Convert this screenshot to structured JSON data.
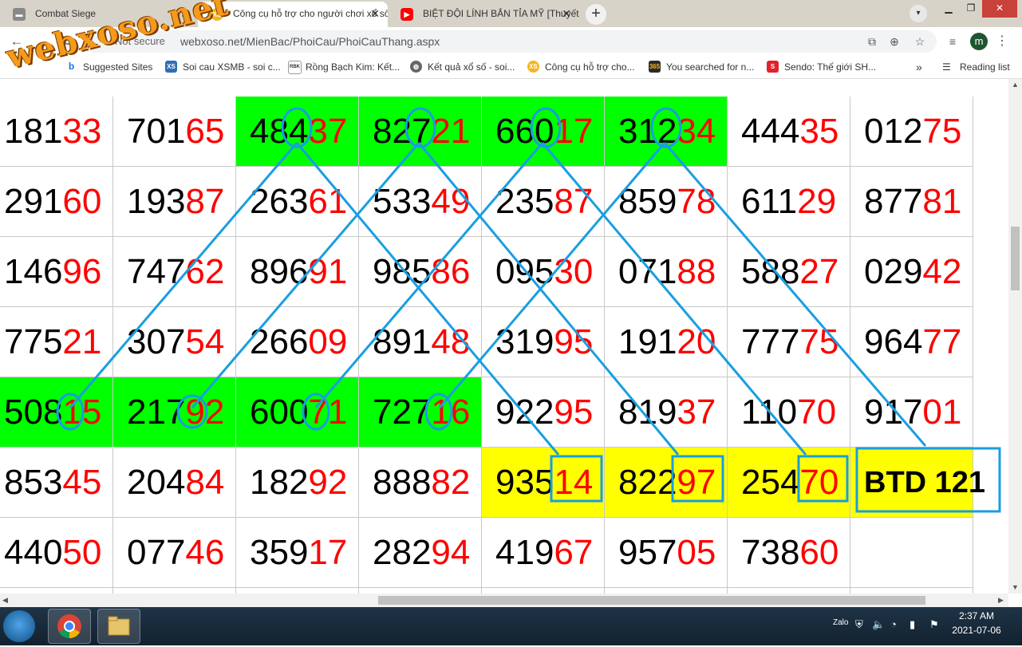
{
  "browser": {
    "tabs": [
      {
        "title": "Combat Siege",
        "icon": "game-icon"
      },
      {
        "title": "Công cụ hỗ trợ cho người chơi xổ số",
        "icon": "xs-icon"
      },
      {
        "title": "BIỆT ĐỘI LÍNH BẮN TỈA MỸ [Thuyết minh]",
        "icon": "youtube-icon"
      }
    ],
    "security_label": "Not secure",
    "url": "webxoso.net/MienBac/PhoiCau/PhoiCauThang.aspx",
    "avatar_letter": "m",
    "bookmarks": [
      {
        "label": "Suggested Sites"
      },
      {
        "label": "Soi cau XSMB - soi c..."
      },
      {
        "label": "Rồng Bạch Kim: Kết..."
      },
      {
        "label": "Kết quả xổ số - soi..."
      },
      {
        "label": "Công cụ hỗ trợ cho..."
      },
      {
        "label": "You searched for n..."
      },
      {
        "label": "Sendo: Thế giới SH..."
      }
    ],
    "bookmarks_more": "»",
    "reading_list": "Reading list"
  },
  "watermark": "webxoso.net",
  "grid": {
    "rows": [
      [
        {
          "p": "181",
          "h": "33"
        },
        {
          "p": "701",
          "h": "65"
        },
        {
          "p": "484",
          "h": "37",
          "bg": "green"
        },
        {
          "p": "827",
          "h": "21",
          "bg": "green"
        },
        {
          "p": "660",
          "h": "17",
          "bg": "green"
        },
        {
          "p": "312",
          "h": "34",
          "bg": "green"
        },
        {
          "p": "444",
          "h": "35"
        },
        {
          "p": "012",
          "h": "75"
        }
      ],
      [
        {
          "p": "291",
          "h": "60"
        },
        {
          "p": "193",
          "h": "87"
        },
        {
          "p": "263",
          "h": "61"
        },
        {
          "p": "533",
          "h": "49"
        },
        {
          "p": "235",
          "h": "87"
        },
        {
          "p": "859",
          "h": "78"
        },
        {
          "p": "611",
          "h": "29"
        },
        {
          "p": "877",
          "h": "81"
        }
      ],
      [
        {
          "p": "146",
          "h": "96"
        },
        {
          "p": "747",
          "h": "62"
        },
        {
          "p": "896",
          "h": "91"
        },
        {
          "p": "985",
          "h": "86"
        },
        {
          "p": "095",
          "h": "30"
        },
        {
          "p": "071",
          "h": "88"
        },
        {
          "p": "588",
          "h": "27"
        },
        {
          "p": "029",
          "h": "42"
        }
      ],
      [
        {
          "p": "775",
          "h": "21"
        },
        {
          "p": "307",
          "h": "54"
        },
        {
          "p": "266",
          "h": "09"
        },
        {
          "p": "891",
          "h": "48"
        },
        {
          "p": "319",
          "h": "95"
        },
        {
          "p": "191",
          "h": "20"
        },
        {
          "p": "777",
          "h": "75"
        },
        {
          "p": "964",
          "h": "77"
        }
      ],
      [
        {
          "p": "508",
          "h": "15",
          "bg": "green"
        },
        {
          "p": "217",
          "h": "92",
          "bg": "green"
        },
        {
          "p": "600",
          "h": "71",
          "bg": "green"
        },
        {
          "p": "727",
          "h": "16",
          "bg": "green"
        },
        {
          "p": "922",
          "h": "95"
        },
        {
          "p": "819",
          "h": "37"
        },
        {
          "p": "110",
          "h": "70"
        },
        {
          "p": "917",
          "h": "01"
        }
      ],
      [
        {
          "p": "853",
          "h": "45"
        },
        {
          "p": "204",
          "h": "84"
        },
        {
          "p": "182",
          "h": "92"
        },
        {
          "p": "888",
          "h": "82"
        },
        {
          "p": "935",
          "h": "14",
          "bg": "yellow"
        },
        {
          "p": "822",
          "h": "97",
          "bg": "yellow"
        },
        {
          "p": "254",
          "h": "70",
          "bg": "yellow"
        },
        {
          "p": "BTD 121",
          "h": "",
          "bg": "yellow",
          "btd": true
        }
      ],
      [
        {
          "p": "440",
          "h": "50"
        },
        {
          "p": "077",
          "h": "46"
        },
        {
          "p": "359",
          "h": "17"
        },
        {
          "p": "282",
          "h": "94"
        },
        {
          "p": "419",
          "h": "67"
        },
        {
          "p": "957",
          "h": "05"
        },
        {
          "p": "738",
          "h": "60"
        },
        {
          "p": "",
          "h": ""
        }
      ],
      [
        {
          "p": "",
          "h": ""
        },
        {
          "p": "",
          "h": ""
        },
        {
          "p": "",
          "h": ""
        },
        {
          "p": "",
          "h": ""
        },
        {
          "p": "",
          "h": ""
        },
        {
          "p": "",
          "h": ""
        },
        {
          "p": "",
          "h": ""
        },
        {
          "p": "",
          "h": ""
        }
      ]
    ]
  },
  "colors": {
    "green": "#00ff00",
    "yellow": "#ffff00",
    "red": "#ff0000",
    "annotation": "#1a9ee0"
  },
  "taskbar": {
    "time": "2:37 AM",
    "date": "2021-07-06",
    "apps": [
      "chrome",
      "file-explorer"
    ]
  }
}
